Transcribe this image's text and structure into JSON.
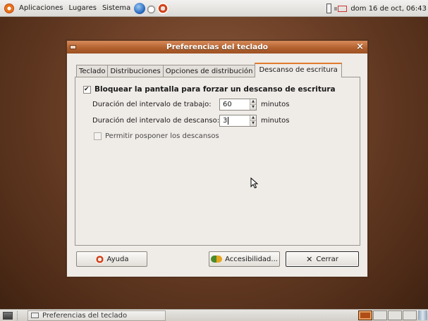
{
  "top_panel": {
    "menus": [
      "Aplicaciones",
      "Lugares",
      "Sistema"
    ],
    "clock": "dom 16 de oct, 06:43"
  },
  "window": {
    "title": "Preferencias del teclado",
    "tabs": [
      {
        "label": "Teclado"
      },
      {
        "label": "Distribuciones"
      },
      {
        "label": "Opciones de distribución"
      },
      {
        "label": "Descanso de escritura"
      }
    ],
    "active_tab": "Descanso de escritura",
    "lock_checkbox_label": "Bloquear la pantalla para forzar un descanso de escritura",
    "work_interval": {
      "label": "Duración del intervalo de trabajo:",
      "value": "60",
      "unit": "minutos"
    },
    "break_interval": {
      "label": "Duración del intervalo de descanso:",
      "value": "3",
      "unit": "minutos"
    },
    "postpone_label": "Permitir posponer los descansos",
    "buttons": {
      "help": "Ayuda",
      "accessibility": "Accesibilidad...",
      "close": "Cerrar"
    }
  },
  "taskbar": {
    "task_label": "Preferencias del teclado"
  },
  "colors": {
    "accent": "#e07b2d",
    "titlebar": "#b3622f",
    "desktop": "#6e4128"
  },
  "icons": [
    "ubuntu-logo-icon",
    "globe-icon",
    "clock-icon",
    "lifebuoy-icon",
    "keyboard-icon",
    "network-icon",
    "help-icon",
    "accessibility-icon",
    "close-icon",
    "trash-icon"
  ]
}
